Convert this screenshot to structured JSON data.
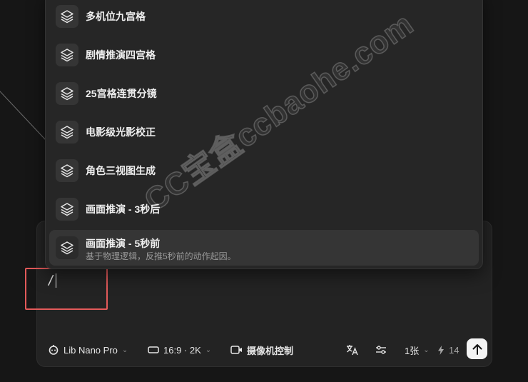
{
  "menu": {
    "items": [
      {
        "label": "多机位九宫格",
        "icon": "layers-icon"
      },
      {
        "label": "剧情推演四宫格",
        "icon": "layers-icon"
      },
      {
        "label": "25宫格连贯分镜",
        "icon": "layers-icon"
      },
      {
        "label": "电影级光影校正",
        "icon": "layers-icon"
      },
      {
        "label": "角色三视图生成",
        "icon": "layers-icon"
      },
      {
        "label": "画面推演 - 3秒后",
        "icon": "layers-icon"
      },
      {
        "label": "画面推演 - 5秒前",
        "description": "基于物理逻辑，反推5秒前的动作起因。",
        "icon": "layers-icon",
        "active": true
      }
    ]
  },
  "prompt": {
    "value": "/"
  },
  "toolbar": {
    "model": "Lib Nano Pro",
    "ratio": "16:9 · 2K",
    "camera": "摄像机控制",
    "count": "1张",
    "credits": "14"
  },
  "watermark": "CC宝盒ccbaohe.com",
  "colors": {
    "highlight": "#e35a5a",
    "background": "#161616",
    "panel": "#232323"
  }
}
